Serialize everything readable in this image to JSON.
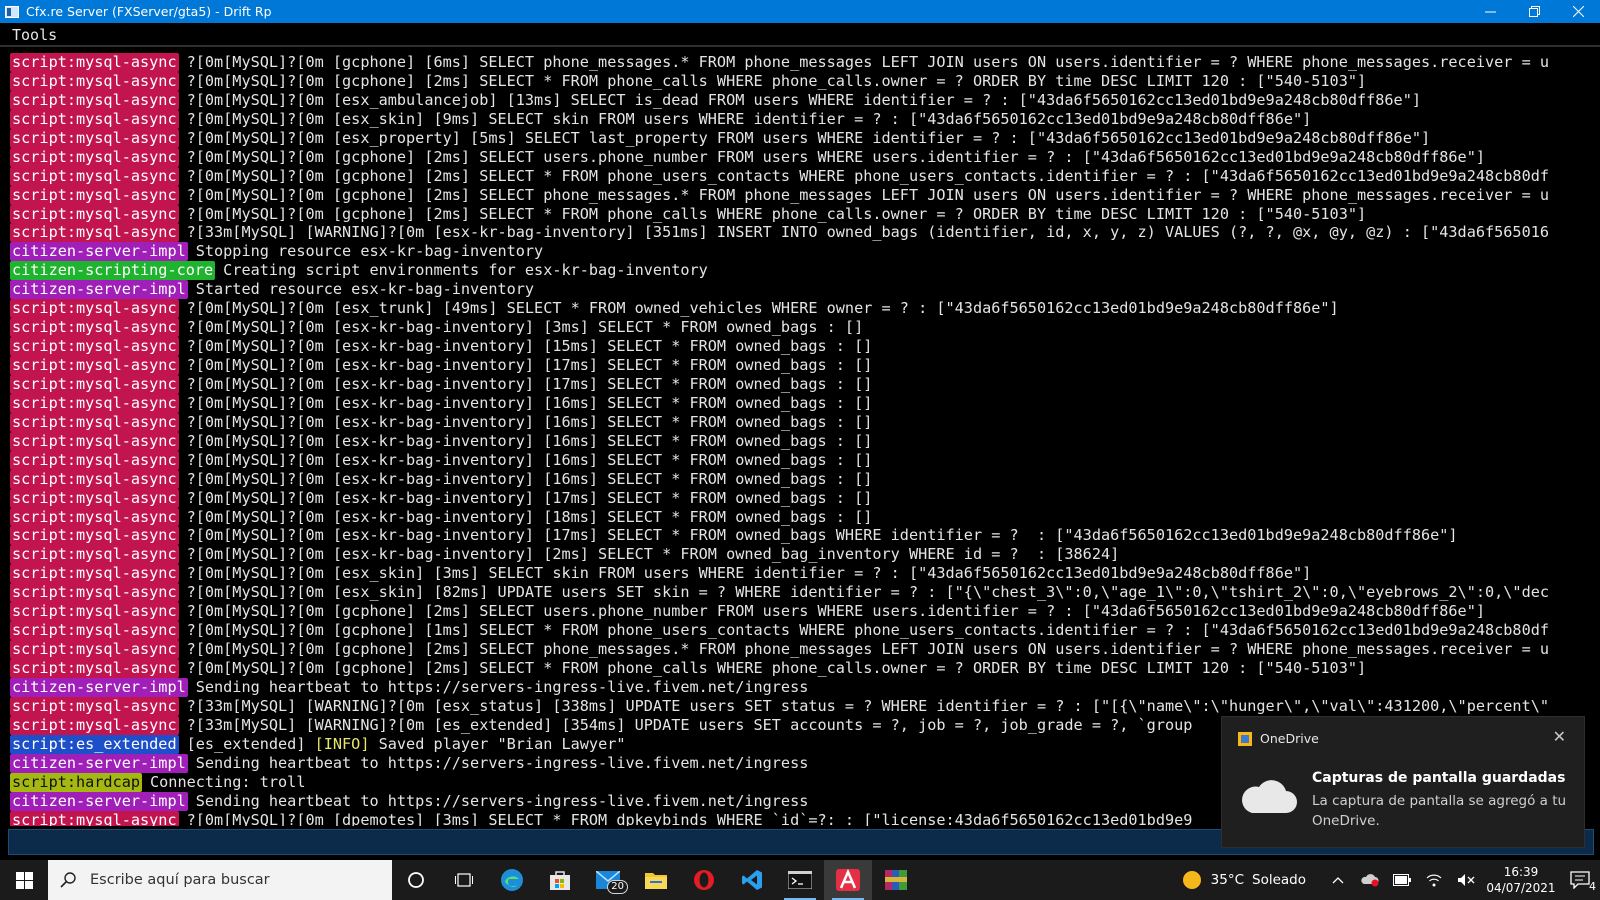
{
  "window": {
    "title": "Cfx.re Server (FXServer/gta5) - Drift Rp",
    "minimize": "—",
    "maximize": "❐",
    "close": "✕"
  },
  "menu": {
    "tools": "Tools"
  },
  "console_lines": [
    {
      "tag": "script:mysql-async",
      "type": "mysql",
      "text": "?[0m[MySQL]?[0m [gcphone] [6ms] SELECT phone_messages.* FROM phone_messages LEFT JOIN users ON users.identifier = ? WHERE phone_messages.receiver = u"
    },
    {
      "tag": "script:mysql-async",
      "type": "mysql",
      "text": "?[0m[MySQL]?[0m [gcphone] [2ms] SELECT * FROM phone_calls WHERE phone_calls.owner = ? ORDER BY time DESC LIMIT 120 : [\"540-5103\"]"
    },
    {
      "tag": "script:mysql-async",
      "type": "mysql",
      "text": "?[0m[MySQL]?[0m [esx_ambulancejob] [13ms] SELECT is_dead FROM users WHERE identifier = ? : [\"43da6f5650162cc13ed01bd9e9a248cb80dff86e\"]"
    },
    {
      "tag": "script:mysql-async",
      "type": "mysql",
      "text": "?[0m[MySQL]?[0m [esx_skin] [9ms] SELECT skin FROM users WHERE identifier = ? : [\"43da6f5650162cc13ed01bd9e9a248cb80dff86e\"]"
    },
    {
      "tag": "script:mysql-async",
      "type": "mysql",
      "text": "?[0m[MySQL]?[0m [esx_property] [5ms] SELECT last_property FROM users WHERE identifier = ? : [\"43da6f5650162cc13ed01bd9e9a248cb80dff86e\"]"
    },
    {
      "tag": "script:mysql-async",
      "type": "mysql",
      "text": "?[0m[MySQL]?[0m [gcphone] [2ms] SELECT users.phone_number FROM users WHERE users.identifier = ? : [\"43da6f5650162cc13ed01bd9e9a248cb80dff86e\"]"
    },
    {
      "tag": "script:mysql-async",
      "type": "mysql",
      "text": "?[0m[MySQL]?[0m [gcphone] [2ms] SELECT * FROM phone_users_contacts WHERE phone_users_contacts.identifier = ? : [\"43da6f5650162cc13ed01bd9e9a248cb80df"
    },
    {
      "tag": "script:mysql-async",
      "type": "mysql",
      "text": "?[0m[MySQL]?[0m [gcphone] [2ms] SELECT phone_messages.* FROM phone_messages LEFT JOIN users ON users.identifier = ? WHERE phone_messages.receiver = u"
    },
    {
      "tag": "script:mysql-async",
      "type": "mysql",
      "text": "?[0m[MySQL]?[0m [gcphone] [2ms] SELECT * FROM phone_calls WHERE phone_calls.owner = ? ORDER BY time DESC LIMIT 120 : [\"540-5103\"]"
    },
    {
      "tag": "script:mysql-async",
      "type": "mysql",
      "text": "?[33m[MySQL] [WARNING]?[0m [esx-kr-bag-inventory] [351ms] INSERT INTO owned_bags (identifier, id, x, y, z) VALUES (?, ?, @x, @y, @z) : [\"43da6f565016"
    },
    {
      "tag": "citizen-server-impl",
      "type": "server",
      "text": "Stopping resource esx-kr-bag-inventory"
    },
    {
      "tag": "citizen-scripting-core",
      "type": "core",
      "text": "Creating script environments for esx-kr-bag-inventory"
    },
    {
      "tag": "citizen-server-impl",
      "type": "server",
      "text": "Started resource esx-kr-bag-inventory"
    },
    {
      "tag": "script:mysql-async",
      "type": "mysql",
      "text": "?[0m[MySQL]?[0m [esx_trunk] [49ms] SELECT * FROM owned_vehicles WHERE owner = ? : [\"43da6f5650162cc13ed01bd9e9a248cb80dff86e\"]"
    },
    {
      "tag": "script:mysql-async",
      "type": "mysql",
      "text": "?[0m[MySQL]?[0m [esx-kr-bag-inventory] [3ms] SELECT * FROM owned_bags : []"
    },
    {
      "tag": "script:mysql-async",
      "type": "mysql",
      "text": "?[0m[MySQL]?[0m [esx-kr-bag-inventory] [15ms] SELECT * FROM owned_bags : []"
    },
    {
      "tag": "script:mysql-async",
      "type": "mysql",
      "text": "?[0m[MySQL]?[0m [esx-kr-bag-inventory] [17ms] SELECT * FROM owned_bags : []"
    },
    {
      "tag": "script:mysql-async",
      "type": "mysql",
      "text": "?[0m[MySQL]?[0m [esx-kr-bag-inventory] [17ms] SELECT * FROM owned_bags : []"
    },
    {
      "tag": "script:mysql-async",
      "type": "mysql",
      "text": "?[0m[MySQL]?[0m [esx-kr-bag-inventory] [16ms] SELECT * FROM owned_bags : []"
    },
    {
      "tag": "script:mysql-async",
      "type": "mysql",
      "text": "?[0m[MySQL]?[0m [esx-kr-bag-inventory] [16ms] SELECT * FROM owned_bags : []"
    },
    {
      "tag": "script:mysql-async",
      "type": "mysql",
      "text": "?[0m[MySQL]?[0m [esx-kr-bag-inventory] [16ms] SELECT * FROM owned_bags : []"
    },
    {
      "tag": "script:mysql-async",
      "type": "mysql",
      "text": "?[0m[MySQL]?[0m [esx-kr-bag-inventory] [16ms] SELECT * FROM owned_bags : []"
    },
    {
      "tag": "script:mysql-async",
      "type": "mysql",
      "text": "?[0m[MySQL]?[0m [esx-kr-bag-inventory] [16ms] SELECT * FROM owned_bags : []"
    },
    {
      "tag": "script:mysql-async",
      "type": "mysql",
      "text": "?[0m[MySQL]?[0m [esx-kr-bag-inventory] [17ms] SELECT * FROM owned_bags : []"
    },
    {
      "tag": "script:mysql-async",
      "type": "mysql",
      "text": "?[0m[MySQL]?[0m [esx-kr-bag-inventory] [18ms] SELECT * FROM owned_bags : []"
    },
    {
      "tag": "script:mysql-async",
      "type": "mysql",
      "text": "?[0m[MySQL]?[0m [esx-kr-bag-inventory] [17ms] SELECT * FROM owned_bags WHERE identifier = ?  : [\"43da6f5650162cc13ed01bd9e9a248cb80dff86e\"]"
    },
    {
      "tag": "script:mysql-async",
      "type": "mysql",
      "text": "?[0m[MySQL]?[0m [esx-kr-bag-inventory] [2ms] SELECT * FROM owned_bag_inventory WHERE id = ?  : [38624]"
    },
    {
      "tag": "script:mysql-async",
      "type": "mysql",
      "text": "?[0m[MySQL]?[0m [esx_skin] [3ms] SELECT skin FROM users WHERE identifier = ? : [\"43da6f5650162cc13ed01bd9e9a248cb80dff86e\"]"
    },
    {
      "tag": "script:mysql-async",
      "type": "mysql",
      "text": "?[0m[MySQL]?[0m [esx_skin] [82ms] UPDATE users SET skin = ? WHERE identifier = ? : [\"{\\\"chest_3\\\":0,\\\"age_1\\\":0,\\\"tshirt_2\\\":0,\\\"eyebrows_2\\\":0,\\\"dec"
    },
    {
      "tag": "script:mysql-async",
      "type": "mysql",
      "text": "?[0m[MySQL]?[0m [gcphone] [2ms] SELECT users.phone_number FROM users WHERE users.identifier = ? : [\"43da6f5650162cc13ed01bd9e9a248cb80dff86e\"]"
    },
    {
      "tag": "script:mysql-async",
      "type": "mysql",
      "text": "?[0m[MySQL]?[0m [gcphone] [1ms] SELECT * FROM phone_users_contacts WHERE phone_users_contacts.identifier = ? : [\"43da6f5650162cc13ed01bd9e9a248cb80df"
    },
    {
      "tag": "script:mysql-async",
      "type": "mysql",
      "text": "?[0m[MySQL]?[0m [gcphone] [2ms] SELECT phone_messages.* FROM phone_messages LEFT JOIN users ON users.identifier = ? WHERE phone_messages.receiver = u"
    },
    {
      "tag": "script:mysql-async",
      "type": "mysql",
      "text": "?[0m[MySQL]?[0m [gcphone] [2ms] SELECT * FROM phone_calls WHERE phone_calls.owner = ? ORDER BY time DESC LIMIT 120 : [\"540-5103\"]"
    },
    {
      "tag": "citizen-server-impl",
      "type": "server",
      "text": "Sending heartbeat to https://servers-ingress-live.fivem.net/ingress"
    },
    {
      "tag": "script:mysql-async",
      "type": "mysql",
      "text": "?[33m[MySQL] [WARNING]?[0m [esx_status] [338ms] UPDATE users SET status = ? WHERE identifier = ? : [\"[{\\\"name\\\":\\\"hunger\\\",\\\"val\\\":431200,\\\"percent\\\""
    },
    {
      "tag": "script:mysql-async",
      "type": "mysql",
      "text": "?[33m[MySQL] [WARNING]?[0m [es_extended] [354ms] UPDATE users SET accounts = ?, job = ?, job_grade = ?, `group"
    },
    {
      "tag": "script:es_extended",
      "type": "es",
      "text": "[es_extended] ",
      "info": "[INFO]",
      "text2": " Saved player \"Brian Lawyer\""
    },
    {
      "tag": "citizen-server-impl",
      "type": "server",
      "text": "Sending heartbeat to https://servers-ingress-live.fivem.net/ingress"
    },
    {
      "tag": "script:hardcap",
      "type": "hardcap",
      "text": "Connecting: troll"
    },
    {
      "tag": "citizen-server-impl",
      "type": "server",
      "text": "Sending heartbeat to https://servers-ingress-live.fivem.net/ingress"
    },
    {
      "tag": "script:mysql-async",
      "type": "mysql",
      "text": "?[0m[MySQL]?[0m [dpemotes] [3ms] SELECT * FROM dpkeybinds WHERE `id`=?: : [\"license:43da6f5650162cc13ed01bd9e9"
    }
  ],
  "taskbar": {
    "search_placeholder": "Escribe aquí para buscar",
    "mail_badge": "20",
    "weather_temp": "35°C",
    "weather_text": "Soleado",
    "time": "16:39",
    "date": "04/07/2021",
    "notification_count": "4"
  },
  "toast": {
    "app": "OneDrive",
    "close": "✕",
    "title": "Capturas de pantalla guardadas",
    "body": "La captura de pantalla se agregó a tu OneDrive."
  },
  "colors": {
    "titlebar": "#0078d7",
    "tag_mysql": "#c2154f",
    "tag_server": "#a11fb9",
    "tag_core": "#1fb42d",
    "tag_es": "#1d4fc8",
    "tag_hardcap": "#a5b812"
  }
}
